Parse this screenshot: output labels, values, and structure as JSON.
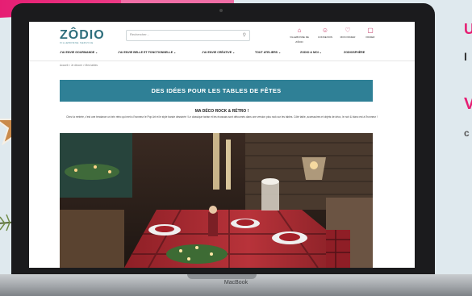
{
  "site": {
    "logo": "ZÔDIO",
    "logo_sub": "VILLEBONNE SERVICE"
  },
  "search": {
    "placeholder": "Rechercher..."
  },
  "header_icons": [
    {
      "label": "VILLEBONNE DE ZÔDIO",
      "icon": "store-icon"
    },
    {
      "label": "CONNEXION",
      "icon": "user-icon"
    },
    {
      "label": "MON PANIER",
      "icon": "cart-icon"
    },
    {
      "label": "PANIER",
      "icon": "bag-icon"
    }
  ],
  "nav": [
    "J'AI ENVIE GOURMANDE ⌄",
    "J'AI ENVIE BELLE ET FONCTIONNELLE ⌄",
    "J'AI ENVIE CRÉATIVE ⌄",
    "TOUT ATELIERS ⌄",
    "ZODIO & MOI ⌄",
    "ZODIOSPHÈRE"
  ],
  "breadcrumb": "Accueil  >  Je décore  >  Mes tables",
  "banner": "DES IDÉES POUR LES TABLES DE FÊTES",
  "section_title": "MA DÉCO ROCK & RÉTRO !",
  "intro": "Chez la rentrée, c'est une tendance un brin rétro qui met à l'honneur le Pop Art et le style bande dessinée ! Le classique tartan et les écossais sont détournés dans une version plus rock sur les tables. Côté table, accessoires et objets de déco, le noir & blanc est à l'honneur !",
  "side_text": {
    "a": "U",
    "b": "I",
    "c": "V",
    "d": "c"
  },
  "laptop_brand": "MacBook",
  "colors": {
    "accent": "#2f8096",
    "pink": "#e61e73",
    "logo": "#2f6f7d"
  }
}
